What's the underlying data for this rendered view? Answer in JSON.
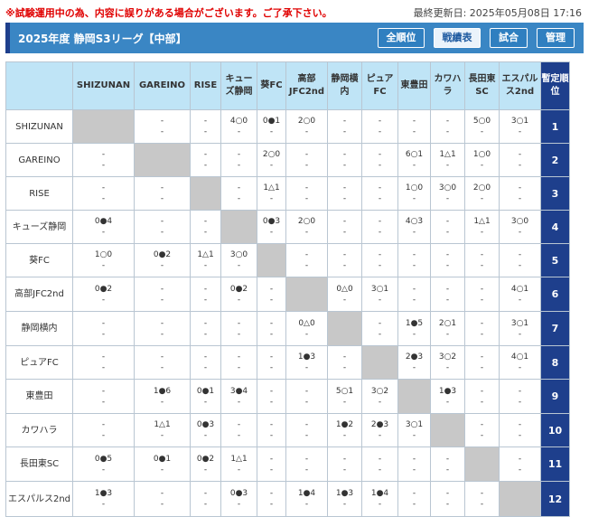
{
  "notice": "※試験運用中の為、内容に誤りがある場合がございます。ご了承下さい。",
  "last_updated": "最終更新日: 2025年05月08日 17:16",
  "header": {
    "title": "2025年度 静岡S3リーグ【中部】",
    "buttons": [
      {
        "label": "全順位",
        "active": false
      },
      {
        "label": "戦績表",
        "active": true
      },
      {
        "label": "試合",
        "active": false
      },
      {
        "label": "管理",
        "active": false
      }
    ]
  },
  "table": {
    "rank_header": "暫定順位",
    "columns": [
      "SHIZUNAN",
      "GAREINO",
      "RISE",
      "キューズ静岡",
      "葵FC",
      "高部JFC2nd",
      "静岡横内",
      "ピュアFC",
      "東豊田",
      "カワハラ",
      "長田東SC",
      "エスパルス2nd"
    ],
    "rows": [
      {
        "team": "SHIZUNAN",
        "rank": "1",
        "cells": [
          null,
          [
            "-",
            "-"
          ],
          [
            "-",
            "-"
          ],
          [
            "4○0",
            "-"
          ],
          [
            "0●1",
            "-"
          ],
          [
            "2○0",
            "-"
          ],
          [
            "-",
            "-"
          ],
          [
            "-",
            "-"
          ],
          [
            "-",
            "-"
          ],
          [
            "-",
            "-"
          ],
          [
            "5○0",
            "-"
          ],
          [
            "3○1",
            "-"
          ]
        ]
      },
      {
        "team": "GAREINO",
        "rank": "2",
        "cells": [
          [
            "-",
            "-"
          ],
          null,
          [
            "-",
            "-"
          ],
          [
            "-",
            "-"
          ],
          [
            "2○0",
            "-"
          ],
          [
            "-",
            "-"
          ],
          [
            "-",
            "-"
          ],
          [
            "-",
            "-"
          ],
          [
            "6○1",
            "-"
          ],
          [
            "1△1",
            "-"
          ],
          [
            "1○0",
            "-"
          ],
          [
            "-",
            "-"
          ]
        ]
      },
      {
        "team": "RISE",
        "rank": "3",
        "cells": [
          [
            "-",
            "-"
          ],
          [
            "-",
            "-"
          ],
          null,
          [
            "-",
            "-"
          ],
          [
            "1△1",
            "-"
          ],
          [
            "-",
            "-"
          ],
          [
            "-",
            "-"
          ],
          [
            "-",
            "-"
          ],
          [
            "1○0",
            "-"
          ],
          [
            "3○0",
            "-"
          ],
          [
            "2○0",
            "-"
          ],
          [
            "-",
            "-"
          ]
        ]
      },
      {
        "team": "キューズ静岡",
        "rank": "4",
        "cells": [
          [
            "0●4",
            "-"
          ],
          [
            "-",
            "-"
          ],
          [
            "-",
            "-"
          ],
          null,
          [
            "0●3",
            "-"
          ],
          [
            "2○0",
            "-"
          ],
          [
            "-",
            "-"
          ],
          [
            "-",
            "-"
          ],
          [
            "4○3",
            "-"
          ],
          [
            "-",
            "-"
          ],
          [
            "1△1",
            "-"
          ],
          [
            "3○0",
            "-"
          ]
        ]
      },
      {
        "team": "葵FC",
        "rank": "5",
        "cells": [
          [
            "1○0",
            "-"
          ],
          [
            "0●2",
            "-"
          ],
          [
            "1△1",
            "-"
          ],
          [
            "3○0",
            "-"
          ],
          null,
          [
            "-",
            "-"
          ],
          [
            "-",
            "-"
          ],
          [
            "-",
            "-"
          ],
          [
            "-",
            "-"
          ],
          [
            "-",
            "-"
          ],
          [
            "-",
            "-"
          ],
          [
            "-",
            "-"
          ]
        ]
      },
      {
        "team": "高部JFC2nd",
        "rank": "6",
        "cells": [
          [
            "0●2",
            "-"
          ],
          [
            "-",
            "-"
          ],
          [
            "-",
            "-"
          ],
          [
            "0●2",
            "-"
          ],
          [
            "-",
            "-"
          ],
          null,
          [
            "0△0",
            "-"
          ],
          [
            "3○1",
            "-"
          ],
          [
            "-",
            "-"
          ],
          [
            "-",
            "-"
          ],
          [
            "-",
            "-"
          ],
          [
            "4○1",
            "-"
          ]
        ]
      },
      {
        "team": "静岡横内",
        "rank": "7",
        "cells": [
          [
            "-",
            "-"
          ],
          [
            "-",
            "-"
          ],
          [
            "-",
            "-"
          ],
          [
            "-",
            "-"
          ],
          [
            "-",
            "-"
          ],
          [
            "0△0",
            "-"
          ],
          null,
          [
            "-",
            "-"
          ],
          [
            "1●5",
            "-"
          ],
          [
            "2○1",
            "-"
          ],
          [
            "-",
            "-"
          ],
          [
            "3○1",
            "-"
          ]
        ]
      },
      {
        "team": "ピュアFC",
        "rank": "8",
        "cells": [
          [
            "-",
            "-"
          ],
          [
            "-",
            "-"
          ],
          [
            "-",
            "-"
          ],
          [
            "-",
            "-"
          ],
          [
            "-",
            "-"
          ],
          [
            "1●3",
            "-"
          ],
          [
            "-",
            "-"
          ],
          null,
          [
            "2●3",
            "-"
          ],
          [
            "3○2",
            "-"
          ],
          [
            "-",
            "-"
          ],
          [
            "4○1",
            "-"
          ]
        ]
      },
      {
        "team": "東豊田",
        "rank": "9",
        "cells": [
          [
            "-",
            "-"
          ],
          [
            "1●6",
            "-"
          ],
          [
            "0●1",
            "-"
          ],
          [
            "3●4",
            "-"
          ],
          [
            "-",
            "-"
          ],
          [
            "-",
            "-"
          ],
          [
            "5○1",
            "-"
          ],
          [
            "3○2",
            "-"
          ],
          null,
          [
            "1●3",
            "-"
          ],
          [
            "-",
            "-"
          ],
          [
            "-",
            "-"
          ]
        ]
      },
      {
        "team": "カワハラ",
        "rank": "10",
        "cells": [
          [
            "-",
            "-"
          ],
          [
            "1△1",
            "-"
          ],
          [
            "0●3",
            "-"
          ],
          [
            "-",
            "-"
          ],
          [
            "-",
            "-"
          ],
          [
            "-",
            "-"
          ],
          [
            "1●2",
            "-"
          ],
          [
            "2●3",
            "-"
          ],
          [
            "3○1",
            "-"
          ],
          null,
          [
            "-",
            "-"
          ],
          [
            "-",
            "-"
          ]
        ]
      },
      {
        "team": "長田東SC",
        "rank": "11",
        "cells": [
          [
            "0●5",
            "-"
          ],
          [
            "0●1",
            "-"
          ],
          [
            "0●2",
            "-"
          ],
          [
            "1△1",
            "-"
          ],
          [
            "-",
            "-"
          ],
          [
            "-",
            "-"
          ],
          [
            "-",
            "-"
          ],
          [
            "-",
            "-"
          ],
          [
            "-",
            "-"
          ],
          [
            "-",
            "-"
          ],
          null,
          [
            "-",
            "-"
          ]
        ]
      },
      {
        "team": "エスパルス2nd",
        "rank": "12",
        "cells": [
          [
            "1●3",
            "-"
          ],
          [
            "-",
            "-"
          ],
          [
            "-",
            "-"
          ],
          [
            "0●3",
            "-"
          ],
          [
            "-",
            "-"
          ],
          [
            "1●4",
            "-"
          ],
          [
            "1●3",
            "-"
          ],
          [
            "1●4",
            "-"
          ],
          [
            "-",
            "-"
          ],
          [
            "-",
            "-"
          ],
          [
            "-",
            "-"
          ],
          null
        ]
      }
    ]
  }
}
